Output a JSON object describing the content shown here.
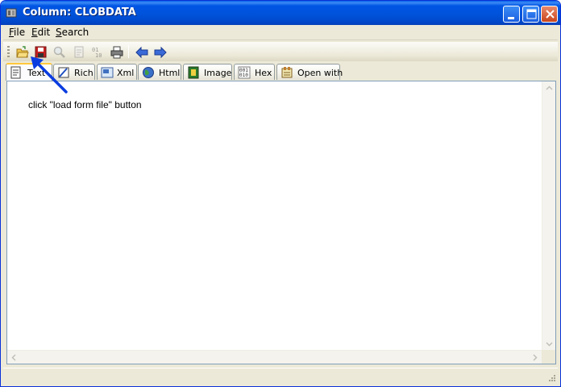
{
  "window": {
    "title": "Column: CLOBDATA"
  },
  "menu": [
    {
      "label": "File",
      "key": "F",
      "rest": "ile"
    },
    {
      "label": "Edit",
      "key": "E",
      "rest": "dit"
    },
    {
      "label": "Search",
      "key": "S",
      "rest": "earch"
    }
  ],
  "toolbar": {
    "open_icon": "open-folder-icon",
    "save_icon": "save-disk-icon",
    "find_icon": "magnifier-icon",
    "copy_icon": "document-icon",
    "hex_icon": "binary-icon",
    "print_icon": "printer-icon",
    "back_icon": "arrow-left-icon",
    "forward_icon": "arrow-right-icon"
  },
  "tabs": [
    {
      "label": "Text",
      "active": true
    },
    {
      "label": "Rich"
    },
    {
      "label": "Xml"
    },
    {
      "label": "Html"
    },
    {
      "label": "Image"
    },
    {
      "label": "Hex"
    },
    {
      "label": "Open with"
    }
  ],
  "content": {
    "text": "click \"load form file\" button"
  },
  "colors": {
    "titlebar": "#0052d9",
    "accent_tab": "#ffc83c",
    "annotation_arrow": "#0a3ce0"
  }
}
